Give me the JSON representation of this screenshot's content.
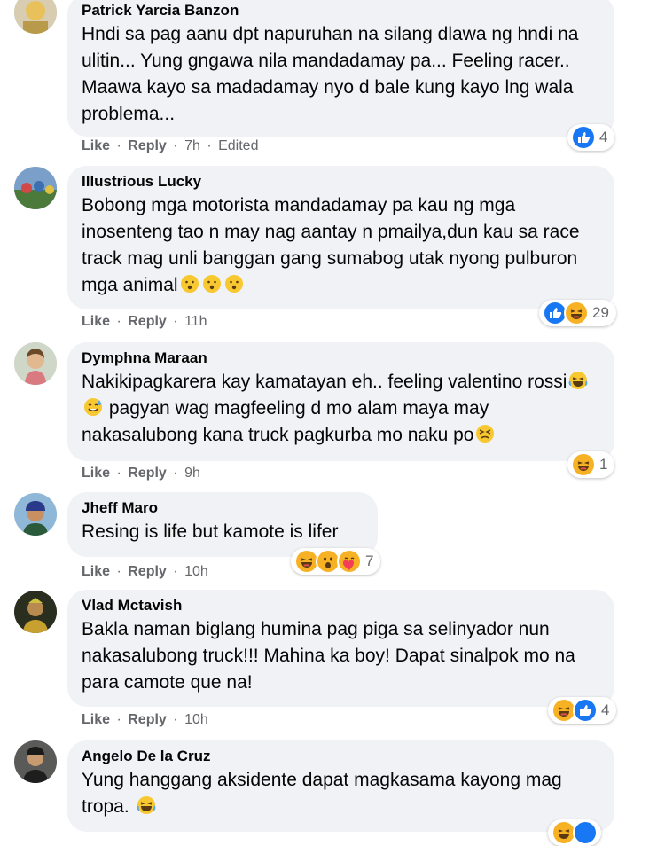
{
  "labels": {
    "like": "Like",
    "reply": "Reply",
    "sep": "·"
  },
  "comments": [
    {
      "author": "Patrick Yarcia Banzon",
      "text": "Hndi sa pag aanu dpt napuruhan na silang dlawa ng hndi na ulitin... Yung gngawa nila mandadamay pa... Feeling racer.. Maawa kayo sa madadamay nyo d bale kung kayo lng wala problema...",
      "time": "7h",
      "edited": "Edited",
      "reactions": [
        "like"
      ],
      "reaction_count": "4"
    },
    {
      "author": "Illustrious Lucky",
      "text": "Bobong mga motorista mandadamay pa kau ng mga inosenteng tao n may nag aantay n pmailya,dun kau sa race track mag unli banggan gang sumabog utak nyong pulburon mga animal",
      "inline_emojis": [
        "worried-face",
        "worried-face",
        "worried-face"
      ],
      "time": "11h",
      "reactions": [
        "like",
        "haha"
      ],
      "reaction_count": "29"
    },
    {
      "author": "Dymphna Maraan",
      "text_parts": [
        "Nakikipagkarera kay kamatayan eh.. feeling valentino rossi",
        " pagyan wag magfeeling d mo alam maya may nakasalubong kana truck pagkurba mo naku po"
      ],
      "inline_emojis_a": [
        "laughing-face",
        "sweat-smile-face"
      ],
      "inline_emojis_b": [
        "persevering-face"
      ],
      "time": "9h",
      "reactions": [
        "haha"
      ],
      "reaction_count": "1"
    },
    {
      "author": "Jheff Maro",
      "text": "Resing is life but kamote is lifer",
      "time": "10h",
      "reactions": [
        "haha",
        "wow",
        "care"
      ],
      "reaction_count": "7"
    },
    {
      "author": "Vlad Mctavish",
      "text": "Bakla naman biglang humina pag piga sa selinyador nun nakasalubong truck!!! Mahina ka boy! Dapat sinalpok mo na para camote que na!",
      "time": "10h",
      "reactions": [
        "haha",
        "like"
      ],
      "reaction_count": "4"
    },
    {
      "author": "Angelo De la Cruz",
      "text": "Yung hanggang aksidente dapat magkasama kayong mag tropa.",
      "inline_emojis": [
        "laughing-face"
      ],
      "reactions": [
        "haha",
        "like"
      ]
    }
  ],
  "colors": {
    "like_blue": "#1877f2",
    "haha_yellow": "#f7b125",
    "bubble_bg": "#f0f2f5",
    "meta_gray": "#65676b"
  }
}
